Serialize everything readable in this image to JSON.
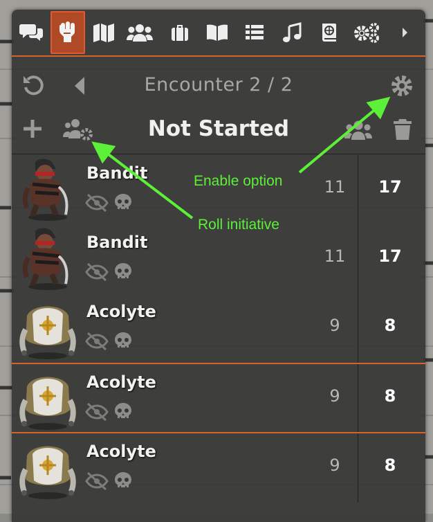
{
  "tabs": [
    {
      "icon": "chat-icon"
    },
    {
      "icon": "combat-fist-icon",
      "active": true
    },
    {
      "icon": "map-icon"
    },
    {
      "icon": "actors-icon"
    },
    {
      "icon": "items-icon"
    },
    {
      "icon": "journal-icon"
    },
    {
      "icon": "tables-icon"
    },
    {
      "icon": "music-icon"
    },
    {
      "icon": "compendium-icon"
    },
    {
      "icon": "settings-icon"
    },
    {
      "icon": "chevron-right-icon"
    }
  ],
  "encounter": {
    "title": "Encounter 2 / 2",
    "status": "Not Started"
  },
  "combatants": [
    {
      "name": "Bandit",
      "initiative_mod": "11",
      "hp": "17",
      "portrait": "bandit"
    },
    {
      "name": "Bandit",
      "initiative_mod": "11",
      "hp": "17",
      "portrait": "bandit"
    },
    {
      "name": "Acolyte",
      "initiative_mod": "9",
      "hp": "8",
      "portrait": "acolyte"
    },
    {
      "name": "Acolyte",
      "initiative_mod": "9",
      "hp": "8",
      "portrait": "acolyte"
    },
    {
      "name": "Acolyte",
      "initiative_mod": "9",
      "hp": "8",
      "portrait": "acolyte"
    }
  ],
  "annotations": {
    "enable_option": "Enable option",
    "roll_initiative": "Roll initiative"
  },
  "colors": {
    "accent": "#d9612a",
    "annotation": "#5cf038"
  }
}
